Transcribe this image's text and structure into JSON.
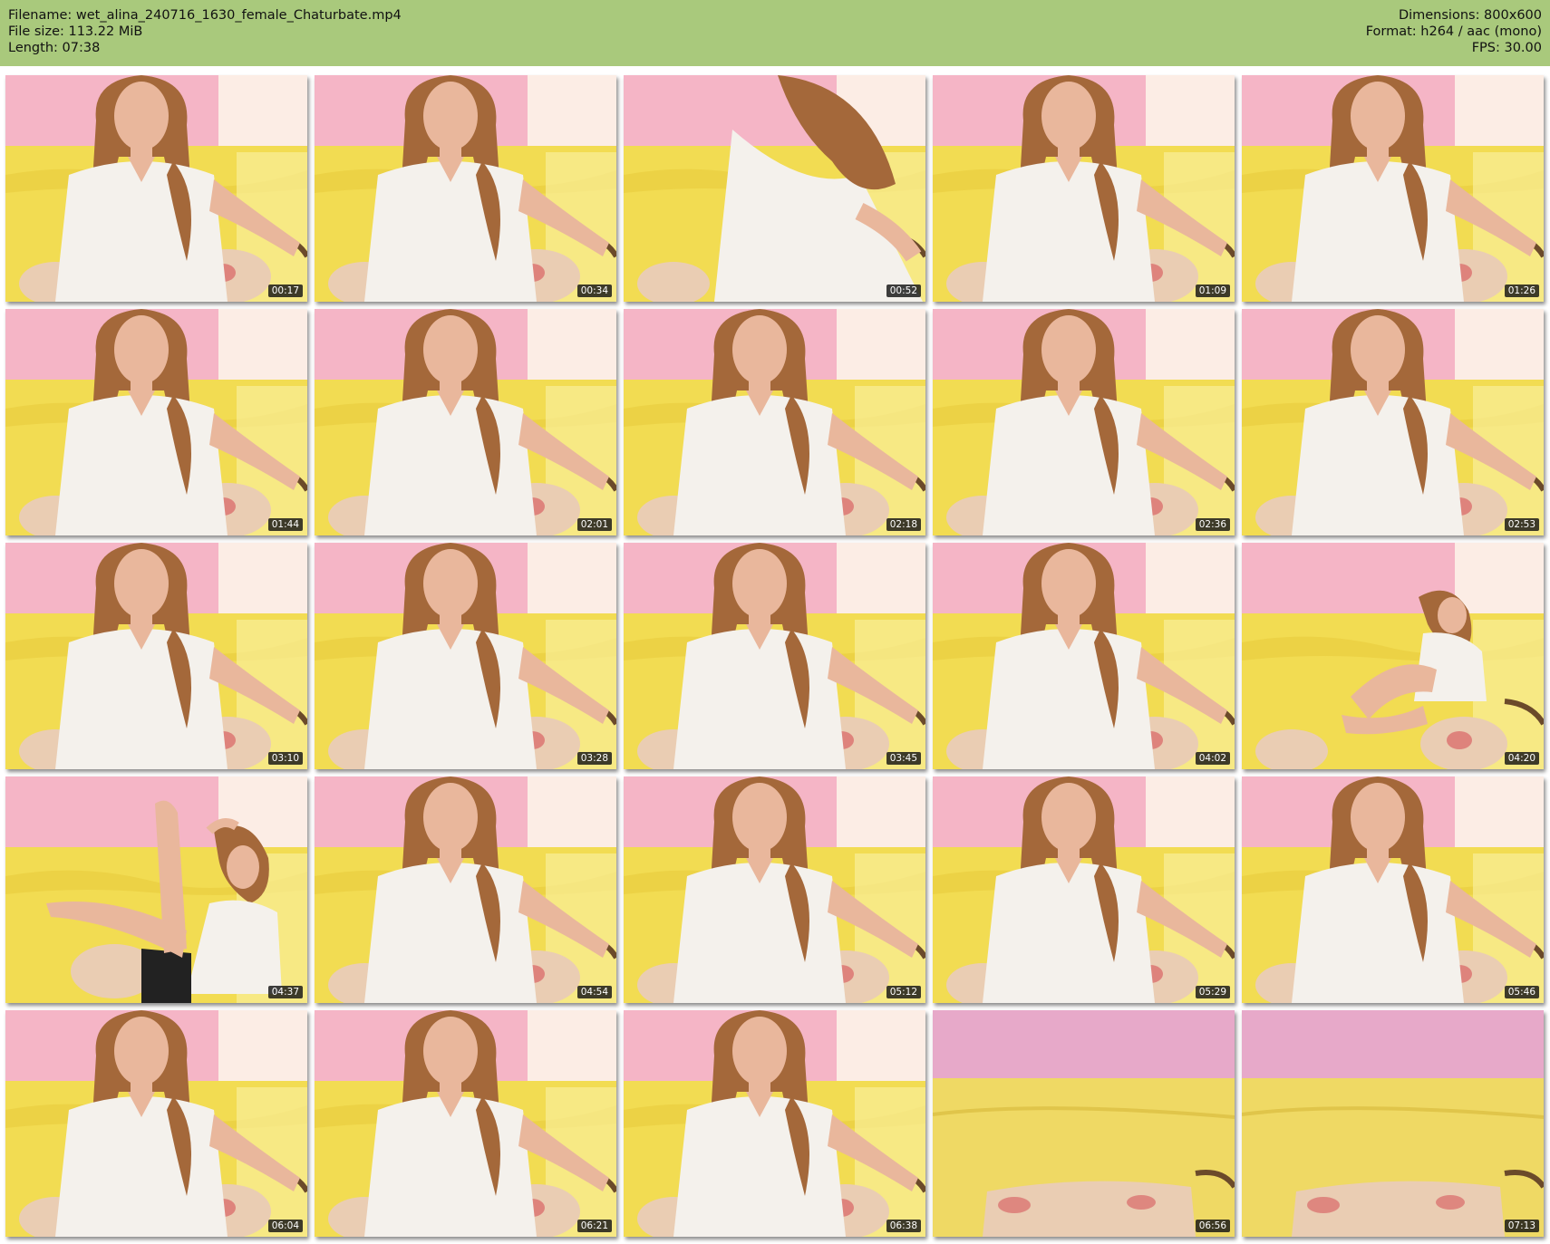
{
  "header": {
    "filename_label": "Filename: wet_alina_240716_1630_female_Chaturbate.mp4",
    "filesize_label": "File size: 113.22 MiB",
    "length_label": "Length: 07:38",
    "dimensions_label": "Dimensions: 800x600",
    "format_label": "Format: h264 / aac (mono)",
    "fps_label": "FPS: 30.00",
    "bg_color": "#a9c97c"
  },
  "thumbnails": [
    {
      "time": "00:17",
      "scene": "seated"
    },
    {
      "time": "00:34",
      "scene": "seated"
    },
    {
      "time": "00:52",
      "scene": "lean"
    },
    {
      "time": "01:09",
      "scene": "seated"
    },
    {
      "time": "01:26",
      "scene": "seated"
    },
    {
      "time": "01:44",
      "scene": "seated"
    },
    {
      "time": "02:01",
      "scene": "seated"
    },
    {
      "time": "02:18",
      "scene": "seated"
    },
    {
      "time": "02:36",
      "scene": "seated"
    },
    {
      "time": "02:53",
      "scene": "seated"
    },
    {
      "time": "03:10",
      "scene": "seated"
    },
    {
      "time": "03:28",
      "scene": "seated"
    },
    {
      "time": "03:45",
      "scene": "seated"
    },
    {
      "time": "04:02",
      "scene": "seated"
    },
    {
      "time": "04:20",
      "scene": "far"
    },
    {
      "time": "04:37",
      "scene": "legs"
    },
    {
      "time": "04:54",
      "scene": "seated"
    },
    {
      "time": "05:12",
      "scene": "seated"
    },
    {
      "time": "05:29",
      "scene": "seated"
    },
    {
      "time": "05:46",
      "scene": "seated"
    },
    {
      "time": "06:04",
      "scene": "seated"
    },
    {
      "time": "06:21",
      "scene": "seated"
    },
    {
      "time": "06:38",
      "scene": "seated"
    },
    {
      "time": "06:56",
      "scene": "empty"
    },
    {
      "time": "07:13",
      "scene": "empty"
    }
  ],
  "colors": {
    "wall_pink": "#f5b5c6",
    "couch_yellow": "#f2dc52",
    "window_light": "#fdf7ea",
    "shirt_white": "#f4f1ec",
    "hair": "#a4683a",
    "skin": "#e9b79c",
    "pillow": "#eacdb3"
  }
}
